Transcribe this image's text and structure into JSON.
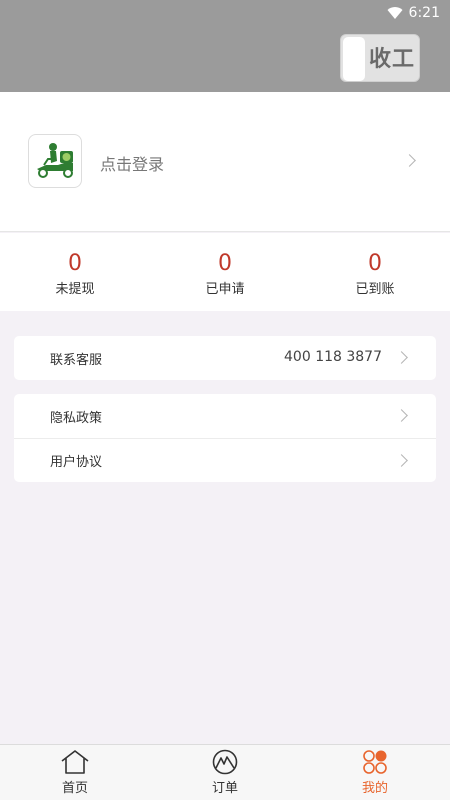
{
  "status_bar": {
    "time": "6:21"
  },
  "header": {
    "toggle_label": "收工"
  },
  "profile": {
    "login_text": "点击登录"
  },
  "stats": [
    {
      "value": "0",
      "label": "未提现"
    },
    {
      "value": "0",
      "label": "已申请"
    },
    {
      "value": "0",
      "label": "已到账"
    }
  ],
  "menu_groups": [
    [
      {
        "label": "联系客服",
        "value": "400 118 3877"
      }
    ],
    [
      {
        "label": "隐私政策"
      },
      {
        "label": "用户协议"
      }
    ]
  ],
  "tabbar": {
    "active": 2,
    "tabs": [
      {
        "label": "首页",
        "icon": "home-icon"
      },
      {
        "label": "订单",
        "icon": "order-icon"
      },
      {
        "label": "我的",
        "icon": "profile-icon"
      }
    ]
  },
  "colors": {
    "accent": "#e8652e",
    "stat_value": "#c0392b",
    "header_bg": "#9b9b9b",
    "logo_green": "#2e7d32"
  }
}
